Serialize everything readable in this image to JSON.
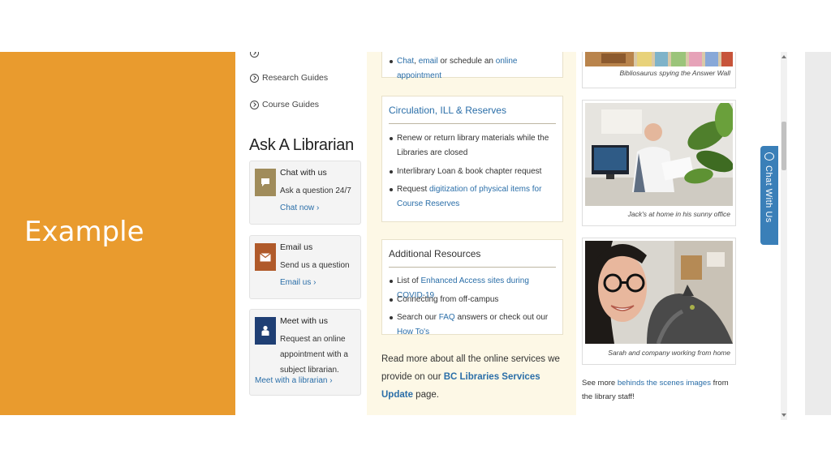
{
  "slide": {
    "title": "Example"
  },
  "colors": {
    "slide_accent": "#e99b2e",
    "link": "#2a6ea8",
    "chat_tab": "#3a7fb8"
  },
  "left_nav": {
    "items": [
      {
        "label": "Research Guides",
        "icon": "circle-arrow-icon"
      },
      {
        "label": "Course Guides",
        "icon": "circle-arrow-icon"
      }
    ]
  },
  "ask": {
    "heading": "Ask A Librarian",
    "chat": {
      "title": "Chat with us",
      "text": "Ask a question 24/7",
      "link": "Chat now ›",
      "icon": "speech-bubble-icon"
    },
    "email": {
      "title": "Email us",
      "text": "Send us a question",
      "link": "Email us ›",
      "icon": "envelope-icon"
    },
    "meet": {
      "title": "Meet with us",
      "text": "Request an online appointment with a subject librarian.",
      "link": "Meet with a librarian ›",
      "icon": "person-icon"
    }
  },
  "top_card": {
    "link1": "Chat",
    "sep": ", ",
    "link2": "email",
    "text": " or schedule an ",
    "link3": "online appointment"
  },
  "circulation": {
    "title": "Circulation, ILL & Reserves",
    "item1": "Renew or return library materials while the Libraries are closed",
    "item2": "Interlibrary Loan & book chapter request",
    "item3_pre": "Request ",
    "item3_link": "digitization of physical items for Course Reserves"
  },
  "resources": {
    "title": "Additional Resources",
    "item1_pre": "List of ",
    "item1_link": "Enhanced Access sites during COVID-19",
    "item2": "Connecting from off-campus",
    "item3_pre": "Search our ",
    "item3_link1": "FAQ",
    "item3_mid": " answers or check out our ",
    "item3_link2": "How To's"
  },
  "readmore": {
    "pre": "Read more about all the online services we provide on our ",
    "link": "BC Libraries Services Update",
    "post": " page."
  },
  "photos": [
    {
      "caption": "Bibliosaurus spying the Answer Wall"
    },
    {
      "caption": "Jack's at home in his sunny office"
    },
    {
      "caption": "Sarah and company working from home"
    }
  ],
  "seemore": {
    "pre": "See more ",
    "link": "behinds the scenes images",
    "post": " from the library staff!"
  },
  "chat_tab": {
    "label": "Chat With Us"
  }
}
